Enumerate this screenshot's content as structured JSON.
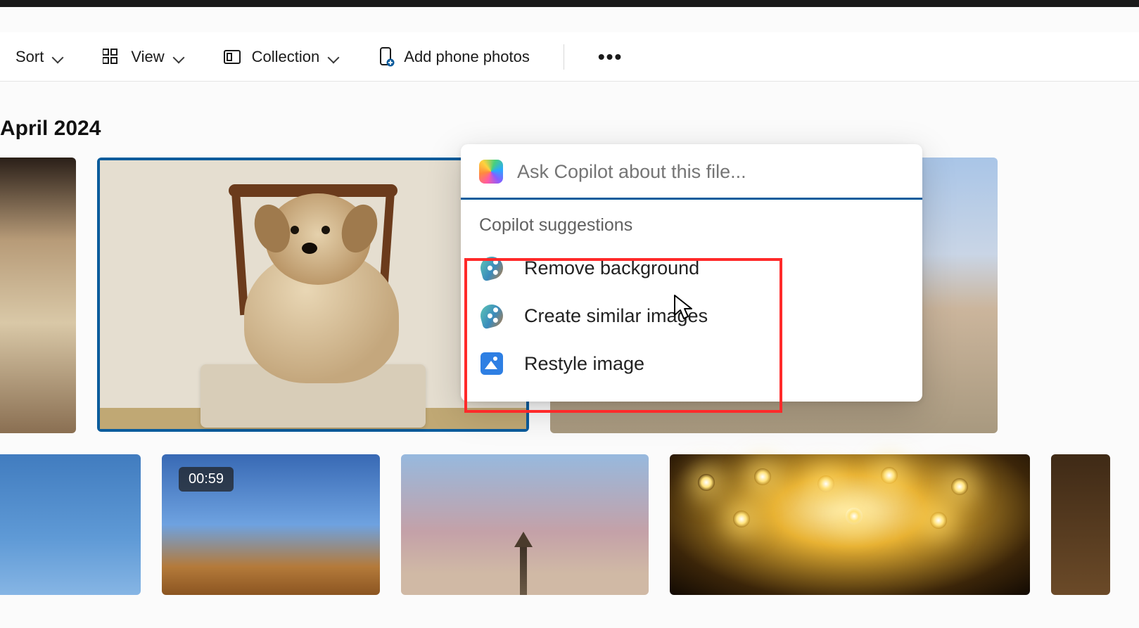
{
  "toolbar": {
    "sort_label": "Sort",
    "view_label": "View",
    "collection_label": "Collection",
    "add_phone_label": "Add phone photos"
  },
  "section_title": "April 2024",
  "video_badge": "00:59",
  "copilot": {
    "placeholder": "Ask Copilot about this file...",
    "suggestions_title": "Copilot suggestions",
    "items": [
      {
        "label": "Remove background"
      },
      {
        "label": "Create similar images"
      },
      {
        "label": "Restyle image"
      }
    ]
  }
}
